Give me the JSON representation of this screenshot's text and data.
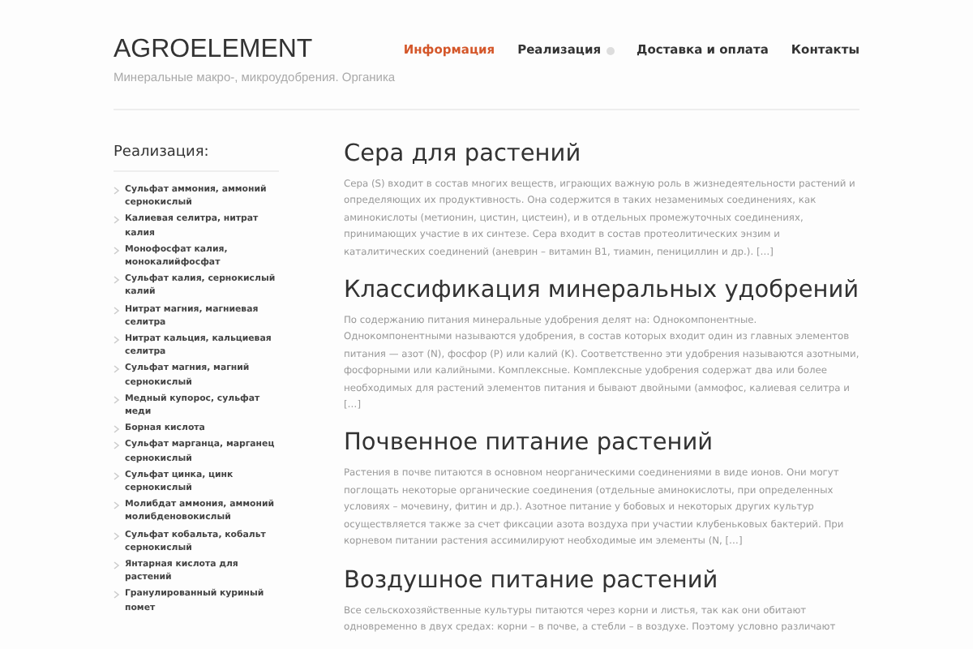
{
  "site": {
    "title": "AGROELEMENT",
    "tagline": "Минеральные макро-, микроудобрения. Органика"
  },
  "nav": [
    {
      "label": "Информация",
      "selected": true,
      "has_submenu": false
    },
    {
      "label": "Реализация",
      "selected": false,
      "has_submenu": true
    },
    {
      "label": "Доставка и оплата",
      "selected": false,
      "has_submenu": false
    },
    {
      "label": "Контакты",
      "selected": false,
      "has_submenu": false
    }
  ],
  "sidebar": {
    "heading": "Реализация:",
    "items": [
      "Сульфат аммония, аммоний сернокислый",
      "Калиевая селитра, нитрат калия",
      "Монофосфат калия, монокалийфосфат",
      "Сульфат калия, сернокислый калий",
      "Нитрат магния, магниевая селитра",
      "Нитрат кальция, кальциевая селитра",
      "Сульфат магния, магний сернокислый",
      "Медный купорос, сульфат меди",
      "Борная кислота",
      "Сульфат марганца, марганец сернокислый",
      "Сульфат цинка, цинк сернокислый",
      "Молибдат аммония, аммоний молибденовокислый",
      "Сульфат кобальта, кобальт сернокислый",
      "Янтарная кислота для растений",
      "Гранулированный куриный помет"
    ]
  },
  "posts": [
    {
      "title": "Сера для растений",
      "excerpt": "Сера (S) входит в состав многих веществ, играющих важную роль в жизнедеятельности растений и определяющих их продуктивность. Она содержится в таких незаменимых соединениях, как аминокислоты (метионин, цистин, цистеин), и в отдельных промежуточных соединениях, принимающих участие в их синтезе. Сера входит в состав протеолитических энзим и каталитических соединений (аневрин – витамин B1, тиамин, пенициллин и др.). […]"
    },
    {
      "title": "Классификация минеральных удобрений",
      "excerpt": "По содержанию питания минеральные удобрения делят на: Однокомпонентные. Однокомпонентными называются удобрения, в состав которых входит один из главных элементов питания — азот (N), фосфор (P) или калий (K). Соответственно эти удобрения называются азотными, фосфорными или калийными. Комплексные. Комплексные удобрения содержат два или более необходимых для растений элементов питания и бывают двойными (аммофос, калиевая селитра и […]"
    },
    {
      "title": "Почвенное питание растений",
      "excerpt": "Растения в почве питаются в основном неорганическими соединениями в виде ионов. Они могут поглощать некоторые органические соединения (отдельные аминокислоты, при определенных условиях – мочевину, фитин и др.). Азотное питание у бобовых и некоторых других культур осуществляется также за счет фиксации азота воздуха при участии клубеньковых бактерий. При корневом питании растения ассимилируют необходимые им элементы (N, […]"
    },
    {
      "title": "Воздушное питание растений",
      "excerpt": "Все сельскохозяйственные культуры питаются через корни и листья, так как они обитают одновременно в двух средах: корни – в почве, а стебли – в воздухе. Поэтому условно различают"
    }
  ]
}
